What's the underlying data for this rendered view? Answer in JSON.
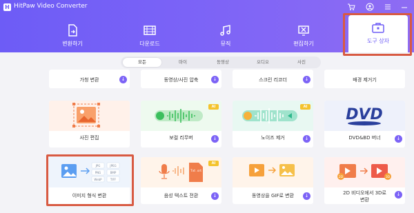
{
  "app_title": "HitPaw Video Converter",
  "nav": [
    {
      "label": "변환하기",
      "icon": "convert-file-icon"
    },
    {
      "label": "다운로드",
      "icon": "film-download-icon"
    },
    {
      "label": "뮤직",
      "icon": "music-note-icon"
    },
    {
      "label": "편집하기",
      "icon": "edit-scissors-icon"
    },
    {
      "label": "도구 상자",
      "icon": "toolbox-icon"
    }
  ],
  "tabs": [
    "모든",
    "마이",
    "동영상",
    "오디오",
    "사진"
  ],
  "cards": [
    {
      "label": "가청 변환",
      "icon": "audible-convert-icon"
    },
    {
      "label": "동영상/사진 압축",
      "icon": "compress-icon"
    },
    {
      "label": "스크린 리코더",
      "icon": "screen-recorder-icon"
    },
    {
      "label": "배경 제거기",
      "icon": "background-remover-icon"
    },
    {
      "label": "사진 편집",
      "icon": "photo-edit-icon"
    },
    {
      "label": "보컬 리무버",
      "icon": "vocal-remover-icon",
      "badge": "AI"
    },
    {
      "label": "노이즈 제거",
      "icon": "noise-remover-icon",
      "badge": "AI"
    },
    {
      "label": "DVD&BD 버너",
      "icon": "dvd-burner-icon",
      "logo_text": "DVD"
    },
    {
      "label": "이미지 형식 변환",
      "icon": "image-converter-icon",
      "formats": [
        "JPG",
        "JPEG",
        "PNG",
        "BMP",
        "WebP",
        "TIFF"
      ]
    },
    {
      "label": "음성 텍스트 전환",
      "icon": "speech-to-text-icon",
      "badge": "AI",
      "doc_text": "Txt .srt"
    },
    {
      "label": "동영상을 GIF로 변환",
      "icon": "video-to-gif-icon"
    },
    {
      "label": "2D 비디오에서 3D로",
      "label2": "변환",
      "icon": "2d-to-3d-icon",
      "tags": [
        "2D",
        "3D"
      ]
    }
  ],
  "colors": {
    "brand": "#6d5cf6",
    "highlight": "#d85a42",
    "ai_badge": "#f4c32c"
  }
}
